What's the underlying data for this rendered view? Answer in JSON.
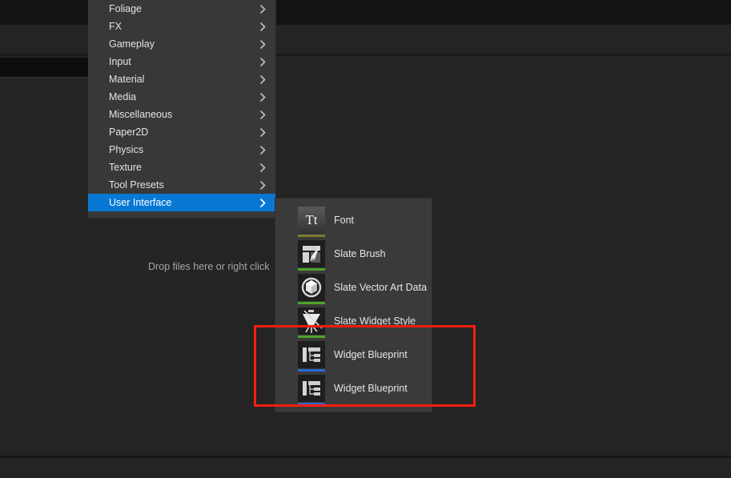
{
  "app": {
    "background_color": "#242424",
    "accent_color": "#0878d4",
    "annotation_color": "#fb1d11"
  },
  "content_browser": {
    "drop_hint": "Drop files here or right click"
  },
  "context_menu": {
    "items": [
      {
        "label": "Foliage",
        "has_submenu": true,
        "arrow": "chevron-right-icon",
        "selected": false
      },
      {
        "label": "FX",
        "has_submenu": true,
        "arrow": "chevron-right-icon",
        "selected": false
      },
      {
        "label": "Gameplay",
        "has_submenu": true,
        "arrow": "chevron-right-icon",
        "selected": false
      },
      {
        "label": "Input",
        "has_submenu": true,
        "arrow": "chevron-right-icon",
        "selected": false
      },
      {
        "label": "Material",
        "has_submenu": true,
        "arrow": "chevron-right-icon",
        "selected": false
      },
      {
        "label": "Media",
        "has_submenu": true,
        "arrow": "chevron-right-icon",
        "selected": false
      },
      {
        "label": "Miscellaneous",
        "has_submenu": true,
        "arrow": "chevron-right-icon",
        "selected": false
      },
      {
        "label": "Paper2D",
        "has_submenu": true,
        "arrow": "chevron-right-icon",
        "selected": false
      },
      {
        "label": "Physics",
        "has_submenu": true,
        "arrow": "chevron-right-icon",
        "selected": false
      },
      {
        "label": "Texture",
        "has_submenu": true,
        "arrow": "chevron-right-icon",
        "selected": false
      },
      {
        "label": "Tool Presets",
        "has_submenu": true,
        "arrow": "chevron-right-icon",
        "selected": false
      },
      {
        "label": "User Interface",
        "has_submenu": true,
        "arrow": "chevron-right-icon",
        "selected": true
      }
    ]
  },
  "submenu": {
    "parent": "User Interface",
    "items": [
      {
        "label": "Font",
        "icon": "font-asset-icon",
        "underline_color": "#7b7a33"
      },
      {
        "label": "Slate Brush",
        "icon": "slate-brush-asset-icon",
        "underline_color": "#4ea427"
      },
      {
        "label": "Slate Vector Art Data",
        "icon": "slate-vector-art-asset-icon",
        "underline_color": "#4ea427"
      },
      {
        "label": "Slate Widget Style",
        "icon": "slate-widget-style-asset-icon",
        "underline_color": "#4ea427"
      },
      {
        "label": "Widget Blueprint",
        "icon": "widget-blueprint-asset-icon",
        "underline_color": "#2a6bd4"
      },
      {
        "label": "Widget Blueprint",
        "icon": "widget-blueprint-asset-icon",
        "underline_color": "#2a6bd4"
      }
    ]
  },
  "annotation": {
    "type": "highlight-rectangle",
    "color": "#fb1d11",
    "targets": [
      "Widget Blueprint",
      "Widget Blueprint"
    ]
  }
}
